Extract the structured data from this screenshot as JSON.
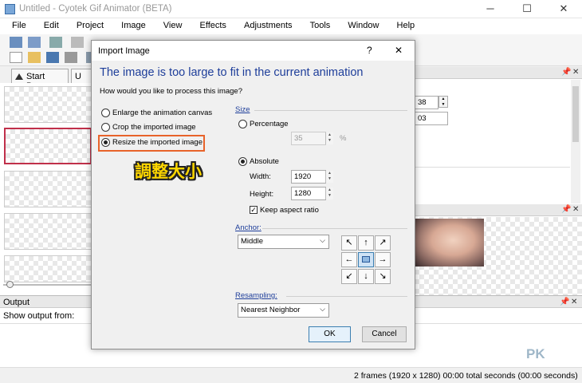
{
  "window": {
    "title": "Untitled - Cyotek Gif Animator (BETA)",
    "minimize": "─",
    "maximize": "☐",
    "close": "✕"
  },
  "menu": [
    "File",
    "Edit",
    "Project",
    "Image",
    "View",
    "Effects",
    "Adjustments",
    "Tools",
    "Window",
    "Help"
  ],
  "tabs": {
    "start_page": "Start Page"
  },
  "properties": {
    "value1": "38",
    "value2": "03"
  },
  "output": {
    "title": "Output",
    "show_from": "Show output from:"
  },
  "status": {
    "text": "2 frames (1920 x 1280)  00:00 total seconds (00:00 seconds)"
  },
  "dialog": {
    "title": "Import Image",
    "help": "?",
    "close": "✕",
    "heading": "The image is too large to fit in the current animation",
    "question": "How would you like to process this image?",
    "options": {
      "enlarge": "Enlarge the animation canvas",
      "crop": "Crop the imported image",
      "resize": "Resize the imported image"
    },
    "size_group": "Size",
    "percentage_label": "Percentage",
    "percentage_value": "35",
    "percent_unit": "%",
    "absolute_label": "Absolute",
    "width_label": "Width:",
    "width_value": "1920",
    "height_label": "Height:",
    "height_value": "1280",
    "keep_aspect": "Keep aspect ratio",
    "anchor_group": "Anchor:",
    "anchor_value": "Middle",
    "resampling_group": "Resampling:",
    "resampling_value": "Nearest Neighbor",
    "ok": "OK",
    "cancel": "Cancel"
  },
  "annotation": "調整大小",
  "watermark": "PK",
  "colors": {
    "accent": "#1e3e9a",
    "highlight_box": "#e8632a",
    "selected_frame": "#c0304a"
  }
}
